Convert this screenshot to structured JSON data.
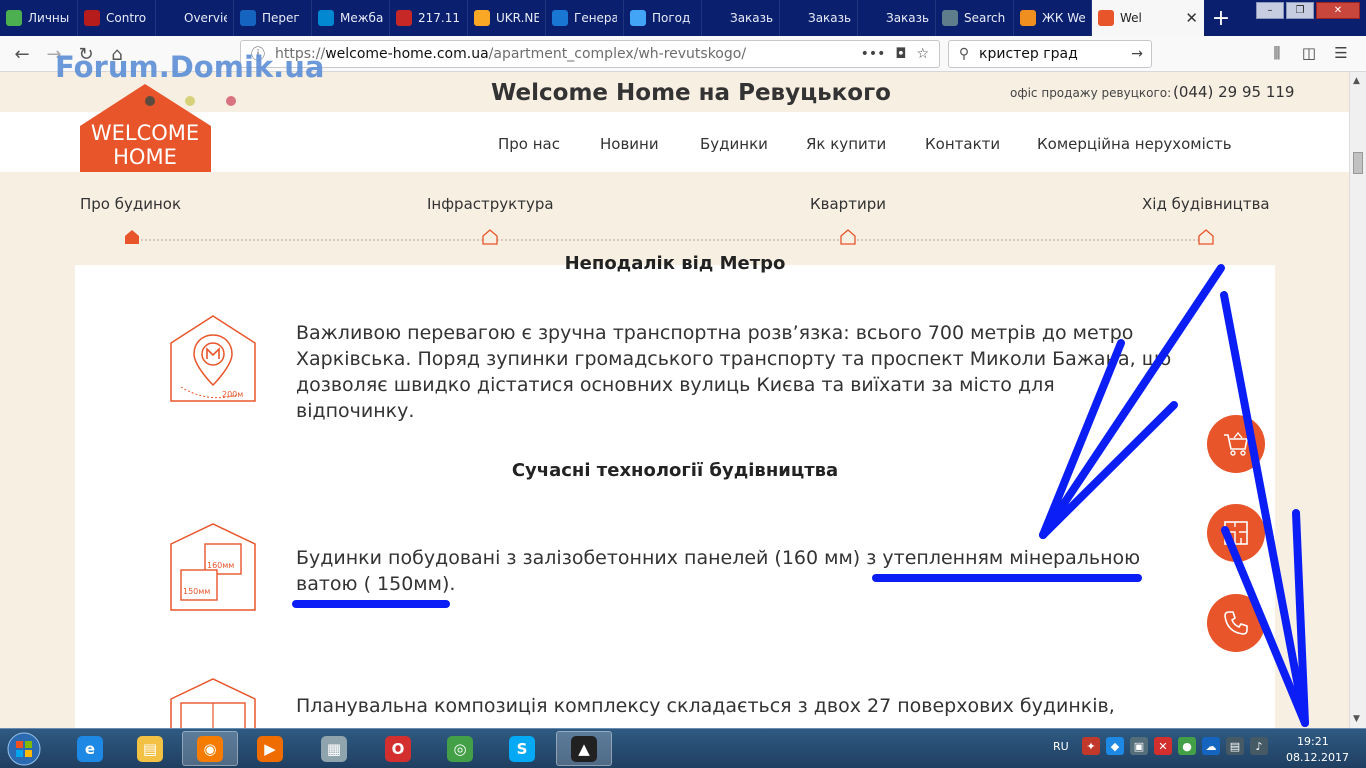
{
  "browser": {
    "tabs": [
      {
        "label": "Личны",
        "fav_color": "#4caf50"
      },
      {
        "label": "Contro",
        "fav_color": "#b71c1c"
      },
      {
        "label": "Overview ‹",
        "fav_color": ""
      },
      {
        "label": "Перег",
        "fav_color": "#1565c0"
      },
      {
        "label": "Межба",
        "fav_color": "#0288d1"
      },
      {
        "label": "217.11",
        "fav_color": "#c62828"
      },
      {
        "label": "UKR.NE",
        "fav_color": "#f9a825"
      },
      {
        "label": "Генера",
        "fav_color": "#1976d2"
      },
      {
        "label": "Погод",
        "fav_color": "#42a5f5"
      },
      {
        "label": "Заказы",
        "fav_color": ""
      },
      {
        "label": "Заказы",
        "fav_color": ""
      },
      {
        "label": "Заказы",
        "fav_color": ""
      },
      {
        "label": "Search",
        "fav_color": "#607d8b"
      },
      {
        "label": "ЖК We",
        "fav_color": "#ef8f1f"
      }
    ],
    "active_tab": {
      "label": "Wel",
      "close": "✕"
    },
    "new_tab": "+",
    "url_prefix": "https://",
    "url_host": "welcome-home.com.ua",
    "url_path": "/apartment_complex/wh-revutskogo/",
    "search_value": "кристер град",
    "page_actions": "•••"
  },
  "watermark": "Forum.Domik.ua",
  "site": {
    "logo_line1": "WELCOME",
    "logo_line2": "HOME",
    "title": "Welcome Home на Ревуцького",
    "office_label": "офіс продажу ревуцкого:",
    "office_phone": "(044) 29 95 119",
    "menu": [
      "Про нас",
      "Новини",
      "Будинки",
      "Як купити",
      "Контакти",
      "Комерційна нерухомість"
    ],
    "steps": [
      "Про будинок",
      "Інфраструктура",
      "Квартири",
      "Хід будівництва"
    ],
    "colors": {
      "accent": "#e8552a",
      "beige": "#f7efe2"
    }
  },
  "content": {
    "partial_heading": "Неподалік від Метро",
    "metro_icon_label": "200м",
    "transport_text": "Важливою перевагою є зручна транспортна розв’язка: всього 700 метрів до метро Харківська. Поряд зупинки громадського транспорту та проспект Миколи Бажана, що дозволяє швидко дістатися основних вулиць Києва та виїхати за місто для відпочинку.",
    "tech_heading": "Сучасні технології будівництва",
    "panel_label_a": "160мм",
    "panel_label_b": "150мм",
    "tech_text": "Будинки побудовані з залізобетонних панелей (160 мм) з утепленням мінеральною ватою ( 150мм).",
    "layout_text": "Планувальна композиція комплексу складається з двох 27 поверхових будинків,"
  },
  "side_buttons": [
    "cart-icon",
    "floorplan-icon",
    "phone-icon"
  ],
  "taskbar": {
    "apps": [
      "ie-icon",
      "explorer-icon",
      "firefox-icon",
      "media-player-icon",
      "calculator-icon",
      "opera-icon",
      "chrome-icon",
      "skype-icon",
      "batman-icon"
    ],
    "lang": "RU",
    "time": "19:21",
    "date": "08.12.2017"
  },
  "annotation_color": "#0a1ef5"
}
